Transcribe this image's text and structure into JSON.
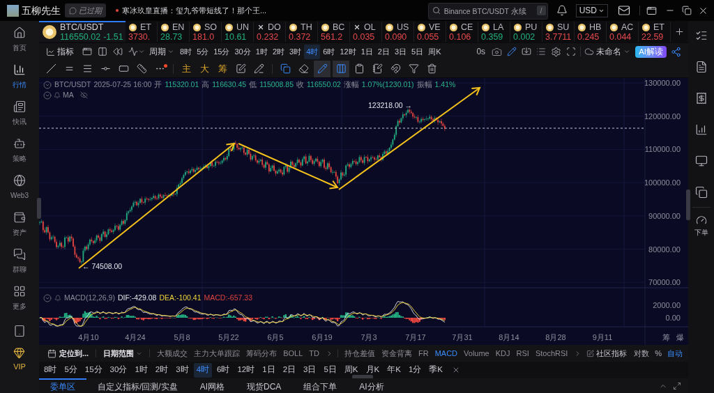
{
  "top_bar": {
    "user_name": "五柳先生",
    "status_badge": "已过期",
    "news": "寒冰玖皇直播：玺九爷带短线了！那个王...",
    "search": {
      "placeholder": "Binance BTC/USDT 永续",
      "shortcut": "/"
    },
    "currency": "USD"
  },
  "sidebar": {
    "items": [
      {
        "label": "首页",
        "selected": false
      },
      {
        "label": "行情",
        "selected": true
      },
      {
        "label": "快讯",
        "selected": false
      },
      {
        "label": "策略",
        "selected": false
      },
      {
        "label": "Web3",
        "selected": false
      },
      {
        "label": "资产",
        "selected": false
      },
      {
        "label": "群聊",
        "selected": false
      },
      {
        "label": "更多",
        "selected": false
      }
    ],
    "vip": "VIP"
  },
  "tickers": [
    {
      "symbol": "BTC/USDT",
      "price": "116550.02",
      "change": "-1.51",
      "color": "#22b07d",
      "kind": "coin",
      "selected": true
    },
    {
      "symbol": "ET",
      "price": "3730.",
      "color": "#e5484d",
      "kind": "coin",
      "selected": false
    },
    {
      "symbol": "EN",
      "price": "28.73",
      "color": "#22b07d",
      "kind": "coin",
      "selected": false
    },
    {
      "symbol": "SO",
      "price": "181.0",
      "color": "#e5484d",
      "kind": "coin",
      "selected": false
    },
    {
      "symbol": "UN",
      "price": "10.61",
      "color": "#22b07d",
      "kind": "coin",
      "selected": false
    },
    {
      "symbol": "DO",
      "price": "0.232",
      "color": "#e5484d",
      "kind": "cross",
      "selected": false
    },
    {
      "symbol": "TH",
      "price": "0.372",
      "color": "#e5484d",
      "kind": "coin",
      "selected": false
    },
    {
      "symbol": "BC",
      "price": "561.2",
      "color": "#e5484d",
      "kind": "coin",
      "selected": false
    },
    {
      "symbol": "OL",
      "price": "0.035",
      "color": "#e5484d",
      "kind": "cross",
      "selected": false
    },
    {
      "symbol": "US",
      "price": "0.090",
      "color": "#e5484d",
      "kind": "coin",
      "selected": false
    },
    {
      "symbol": "VE",
      "price": "0.055",
      "color": "#e5484d",
      "kind": "coin",
      "selected": false
    },
    {
      "symbol": "CE",
      "price": "0.106",
      "color": "#e5484d",
      "kind": "coin",
      "selected": false
    },
    {
      "symbol": "LA",
      "price": "0.359",
      "color": "#22b07d",
      "kind": "coin",
      "selected": false
    },
    {
      "symbol": "PU",
      "price": "0.002",
      "color": "#22b07d",
      "kind": "coin",
      "selected": false
    },
    {
      "symbol": "SU",
      "price": "3.7711",
      "color": "#e5484d",
      "kind": "coin",
      "selected": false
    },
    {
      "symbol": "HB",
      "price": "0.245",
      "color": "#e5484d",
      "kind": "coin",
      "selected": false
    },
    {
      "symbol": "AC",
      "price": "0.044",
      "color": "#e5484d",
      "kind": "coin",
      "selected": false
    },
    {
      "symbol": "ET",
      "price": "22.59",
      "color": "#e5484d",
      "kind": "coin",
      "selected": false
    }
  ],
  "chart_toolbar": {
    "indicator_button": "指标",
    "period_button": "周期",
    "timeframes": [
      {
        "label": "8时",
        "selected": false
      },
      {
        "label": "5分",
        "selected": false
      },
      {
        "label": "15分",
        "selected": false
      },
      {
        "label": "30分",
        "selected": false
      },
      {
        "label": "1时",
        "selected": false
      },
      {
        "label": "2时",
        "selected": false
      },
      {
        "label": "3时",
        "selected": false
      },
      {
        "label": "4时",
        "selected": true
      },
      {
        "label": "6时",
        "selected": false
      },
      {
        "label": "12时",
        "selected": false
      },
      {
        "label": "1日",
        "selected": false
      },
      {
        "label": "2日",
        "selected": false
      },
      {
        "label": "3日",
        "selected": false
      },
      {
        "label": "5日",
        "selected": false
      },
      {
        "label": "周K",
        "selected": false
      }
    ],
    "countdown": "0s",
    "draw_mode": true,
    "layout_name": "未命名",
    "ai_button": "AI解读"
  },
  "drawing_toolbar": {
    "quick_tools": [
      "主",
      "大",
      "筹"
    ],
    "toggles": [
      {
        "active": true
      },
      {
        "active": true
      }
    ]
  },
  "chart": {
    "header": {
      "symbol": "BTC/USDT",
      "datetime": "2025-07-25 16:00",
      "fields": [
        {
          "label": "开",
          "value": "115320.01"
        },
        {
          "label": "高",
          "value": "116630.45"
        },
        {
          "label": "低",
          "value": "115008.85"
        },
        {
          "label": "收",
          "value": "116550.02"
        },
        {
          "label": "涨幅",
          "value": "1.07%(1230.01)"
        },
        {
          "label": "振幅",
          "value": "1.41%"
        }
      ]
    },
    "overlay_label": "MA",
    "high_marker": "123218.00 →",
    "low_marker": "← 74508.00",
    "price_axis": [
      "130000.00",
      "120000.00",
      "110000.00",
      "100000.00",
      "90000.00",
      "80000.00",
      "70000.00"
    ],
    "macd": {
      "title": "MACD(12,26,9)",
      "readings": [
        {
          "text": "DIF:-429.08",
          "color": "#e8e8ec"
        },
        {
          "text": "DEA:-100.41",
          "color": "#f0d43a"
        },
        {
          "text": "MACD:-657.33",
          "color": "#e0443e"
        }
      ],
      "axis": [
        "2000.00",
        "0.00"
      ]
    },
    "date_axis": [
      "4月10",
      "4月24",
      "5月8",
      "5月22",
      "6月5",
      "6月19",
      "7月3",
      "7月17",
      "7月31",
      "8月14",
      "8月28",
      "9月11"
    ],
    "side_labels": [
      "筹",
      "爆"
    ]
  },
  "indicator_bar": {
    "locate_button": "定位到...",
    "date_range": "日期范围",
    "main_indicators": [
      {
        "label": "大额成交",
        "selected": false
      },
      {
        "label": "主力大单跟踪",
        "selected": false
      },
      {
        "label": "筹码分布",
        "selected": false
      },
      {
        "label": "BOLL",
        "selected": false
      },
      {
        "label": "TD",
        "selected": false
      }
    ],
    "sub_indicators": [
      {
        "label": "持仓差值",
        "selected": false
      },
      {
        "label": "资金背离",
        "selected": false
      },
      {
        "label": "FR",
        "selected": false
      },
      {
        "label": "MACD",
        "selected": true
      },
      {
        "label": "Volume",
        "selected": false
      },
      {
        "label": "KDJ",
        "selected": false
      },
      {
        "label": "RSI",
        "selected": false
      },
      {
        "label": "StochRSI",
        "selected": false
      }
    ],
    "community_button": "社区指标",
    "scales": [
      {
        "label": "对数",
        "selected": false
      },
      {
        "label": "%",
        "selected": false
      },
      {
        "label": "自动",
        "selected": true
      }
    ]
  },
  "timeframe_bar": {
    "items": [
      {
        "label": "8时",
        "selected": false
      },
      {
        "label": "5分",
        "selected": false
      },
      {
        "label": "15分",
        "selected": false
      },
      {
        "label": "30分",
        "selected": false
      },
      {
        "label": "1时",
        "selected": false
      },
      {
        "label": "2时",
        "selected": false
      },
      {
        "label": "3时",
        "selected": false
      },
      {
        "label": "4时",
        "selected": true
      },
      {
        "label": "6时",
        "selected": false
      },
      {
        "label": "12时",
        "selected": false
      },
      {
        "label": "1日",
        "selected": false
      },
      {
        "label": "2日",
        "selected": false
      },
      {
        "label": "3日",
        "selected": false
      },
      {
        "label": "5日",
        "selected": false
      },
      {
        "label": "周K",
        "selected": false
      },
      {
        "label": "月K",
        "selected": false
      },
      {
        "label": "年K",
        "selected": false
      },
      {
        "label": "1分",
        "selected": false
      },
      {
        "label": "季K",
        "selected": false
      }
    ]
  },
  "panel_tabs": [
    {
      "label": "委单区",
      "selected": true
    },
    {
      "label": "自定义指标/回测/实盘",
      "selected": false
    },
    {
      "label": "AI网格",
      "selected": false
    },
    {
      "label": "现货DCA",
      "selected": false
    },
    {
      "label": "组合下单",
      "selected": false
    },
    {
      "label": "AI分析",
      "selected": false
    }
  ],
  "right_sidebar": {
    "order_label": "下单"
  }
}
